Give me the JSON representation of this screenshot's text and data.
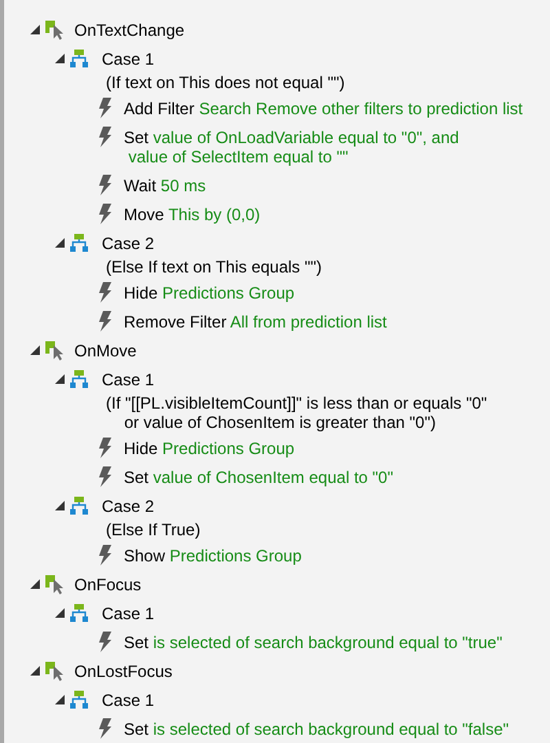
{
  "events": [
    {
      "name": "OnTextChange",
      "expanded": true,
      "cases": [
        {
          "label": "Case 1",
          "expanded": true,
          "condition": [
            "(If text on This does not equal \"\")"
          ],
          "actions": [
            {
              "verb": "Add Filter",
              "target": [
                "Search Remove other filters to prediction list"
              ]
            },
            {
              "verb": "Set",
              "target": [
                "value of OnLoadVariable equal to \"0\", and",
                "value of SelectItem equal to \"\""
              ]
            },
            {
              "verb": "Wait",
              "target": [
                "50 ms"
              ]
            },
            {
              "verb": "Move",
              "target": [
                "This by (0,0)"
              ]
            }
          ]
        },
        {
          "label": "Case 2",
          "expanded": true,
          "condition": [
            "(Else If text on This equals \"\")"
          ],
          "actions": [
            {
              "verb": "Hide",
              "target": [
                "Predictions Group"
              ]
            },
            {
              "verb": "Remove Filter",
              "target": [
                "All from prediction list"
              ]
            }
          ]
        }
      ]
    },
    {
      "name": "OnMove",
      "expanded": true,
      "cases": [
        {
          "label": "Case 1",
          "expanded": true,
          "condition": [
            "(If \"[[PL.visibleItemCount]]\" is less than or equals \"0\"",
            "or value of ChosenItem is greater than \"0\")"
          ],
          "actions": [
            {
              "verb": "Hide",
              "target": [
                "Predictions Group"
              ]
            },
            {
              "verb": "Set",
              "target": [
                "value of ChosenItem equal to \"0\""
              ]
            }
          ]
        },
        {
          "label": "Case 2",
          "expanded": true,
          "condition": [
            "(Else If True)"
          ],
          "actions": [
            {
              "verb": "Show",
              "target": [
                "Predictions Group"
              ]
            }
          ]
        }
      ]
    },
    {
      "name": "OnFocus",
      "expanded": true,
      "cases": [
        {
          "label": "Case 1",
          "expanded": true,
          "actions": [
            {
              "verb": "Set",
              "target": [
                "is selected of search background equal to \"true\""
              ]
            }
          ]
        }
      ]
    },
    {
      "name": "OnLostFocus",
      "expanded": true,
      "cases": [
        {
          "label": "Case 1",
          "expanded": true,
          "actions": [
            {
              "verb": "Set",
              "target": [
                "is selected of search background equal to \"false\""
              ]
            }
          ]
        }
      ]
    }
  ]
}
